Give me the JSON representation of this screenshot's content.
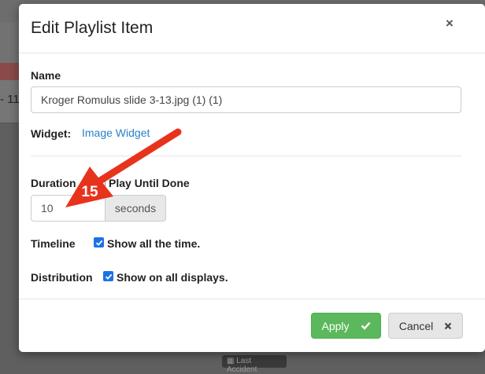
{
  "background": {
    "left_text": "- 11",
    "chip_text": "Last Accident"
  },
  "modal": {
    "title": "Edit Playlist Item",
    "close_glyph": "×",
    "name_label": "Name",
    "name_value": "Kroger Romulus slide 3-13.jpg (1) (1)",
    "widget_label": "Widget:",
    "widget_link": "Image Widget",
    "duration_label": "Duration",
    "play_until_done_label": "Play Until Done",
    "duration_value": "10",
    "duration_unit": "seconds",
    "timeline_label": "Timeline",
    "timeline_check_label": "Show all the time.",
    "distribution_label": "Distribution",
    "distribution_check_label": "Show on all displays.",
    "apply_label": "Apply",
    "cancel_label": "Cancel"
  },
  "annotation": {
    "arrow_color": "#e8331c",
    "number": "15"
  },
  "colors": {
    "accent_link": "#2a7fc9",
    "apply_green": "#5cb85c",
    "checkbox_blue": "#1a73e8"
  }
}
